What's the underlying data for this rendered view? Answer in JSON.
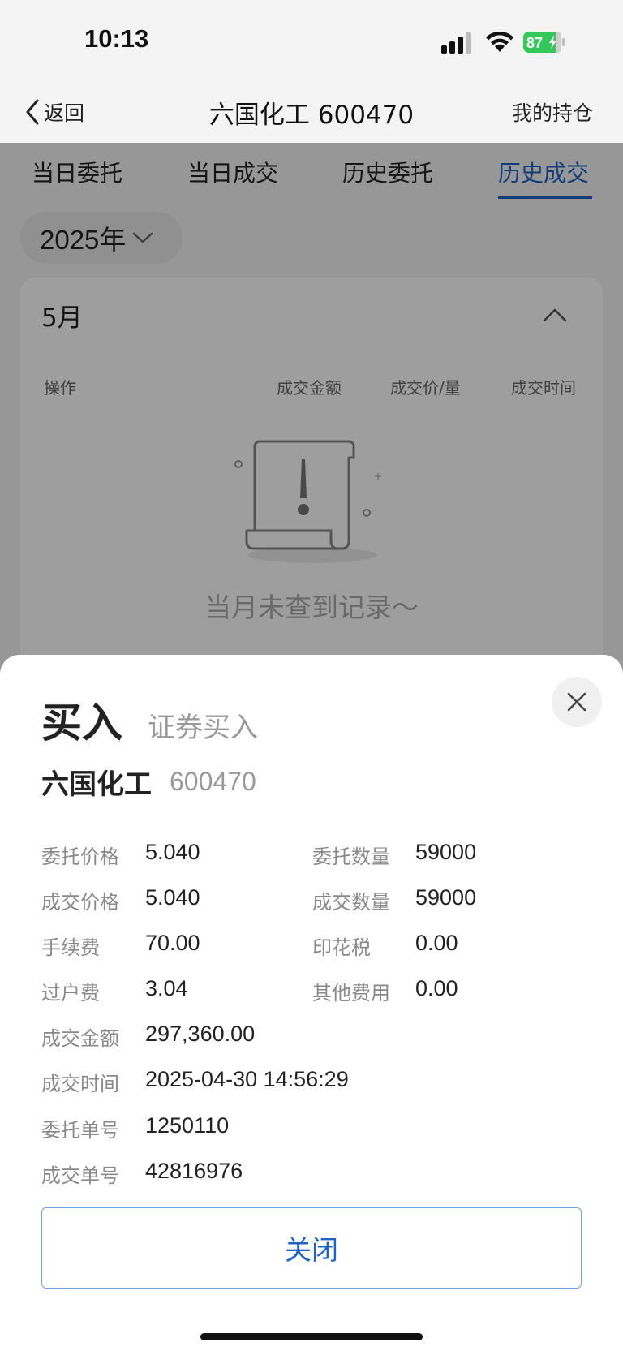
{
  "status": {
    "time": "10:13",
    "battery": "87"
  },
  "nav": {
    "back_label": "返回",
    "title": "六国化工 600470",
    "right_label": "我的持仓"
  },
  "tabs": [
    {
      "label": "当日委托"
    },
    {
      "label": "当日成交"
    },
    {
      "label": "历史委托"
    },
    {
      "label": "历史成交",
      "active": true
    }
  ],
  "filter": {
    "year": "2025年"
  },
  "records": {
    "month": "5月",
    "columns": [
      "操作",
      "成交金额",
      "成交价/量",
      "成交时间"
    ],
    "empty_text": "当月未查到记录～"
  },
  "sheet": {
    "title": "买入",
    "subtitle": "证券买入",
    "stock_name": "六国化工",
    "stock_code": "600470",
    "rows": [
      {
        "label": "委托价格",
        "value": "5.040"
      },
      {
        "label": "委托数量",
        "value": "59000"
      },
      {
        "label": "成交价格",
        "value": "5.040"
      },
      {
        "label": "成交数量",
        "value": "59000"
      },
      {
        "label": "手续费",
        "value": "70.00"
      },
      {
        "label": "印花税",
        "value": "0.00"
      },
      {
        "label": "过户费",
        "value": "3.04"
      },
      {
        "label": "其他费用",
        "value": "0.00"
      },
      {
        "label": "成交金额",
        "value": "297,360.00"
      },
      {
        "label": "成交时间",
        "value": "2025-04-30 14:56:29"
      },
      {
        "label": "委托单号",
        "value": "1250110"
      },
      {
        "label": "成交单号",
        "value": "42816976"
      }
    ],
    "close_button": "关闭"
  },
  "colors": {
    "accent": "#1f63c6",
    "battery_green": "#34c759"
  }
}
